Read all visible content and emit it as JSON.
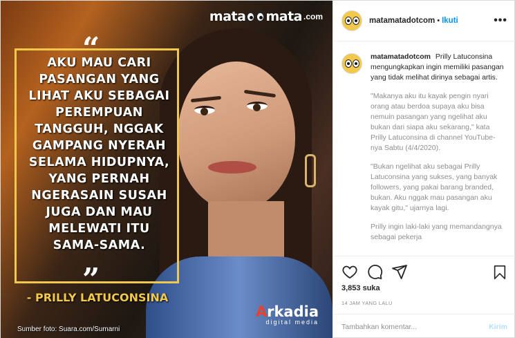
{
  "post_image": {
    "brand_top": {
      "left": "mata",
      "right": "mata",
      "tld": ".com"
    },
    "quote_open": "“",
    "quote_lines": [
      "AKU MAU CARI",
      "PASANGAN YANG",
      "LIHAT AKU SEBAGAI",
      "PEREMPUAN",
      "TANGGUH, NGGAK",
      "GAMPANG NYERAH",
      "SELAMA HIDUPNYA,",
      "YANG PERNAH",
      "NGERASAIN SUSAH",
      "JUGA DAN MAU",
      "MELEWATI ITU",
      "SAMA-SAMA."
    ],
    "quote_close": "”",
    "author": "- PRILLY LATUCONSINA",
    "brand_bottom": {
      "a": "A",
      "rest": "rkadia",
      "tagline": "digital media"
    },
    "photo_credit": "Sumber foto: Suara.com/Sumarni"
  },
  "header": {
    "username": "matamatadotcom",
    "separator": "•",
    "follow_label": "Ikuti",
    "more_label": "•••"
  },
  "caption": {
    "username": "matamatadotcom",
    "intro": "Prilly Latuconsina mengungkapkan ingin memiliki pasangan yang tidak melihat dirinya sebagai artis.",
    "paragraphs": [
      "\"Makanya aku itu kayak pengin nyari orang atau berdoa supaya aku bisa nemuin pasangan yang ngelihat aku bukan dari siapa aku sekarang,\" kata Prilly Latuconsina di channel YouTube-nya Sabtu (4/4/2020).",
      "\"Bukan ngelihat aku sebagai Prilly Latuconsina yang sukses, yang banyak followers, yang pakai barang branded, bukan. Aku nggak mau pasangan aku kayak gitu,\" ujarnya lagi.",
      "Prilly ingin laki-laki yang memandangnya sebagai pekerja"
    ]
  },
  "likes": "3,853 suka",
  "timestamp": "14 JAM YANG LALU",
  "comment": {
    "placeholder": "Tambahkan komentar...",
    "post_label": "Kirim"
  },
  "colors": {
    "accent": "#0095f6",
    "quote_border": "#f2c94c",
    "brand_red": "#e8422c"
  },
  "icons": [
    "heart-icon",
    "comment-icon",
    "share-icon",
    "bookmark-icon",
    "more-icon"
  ]
}
